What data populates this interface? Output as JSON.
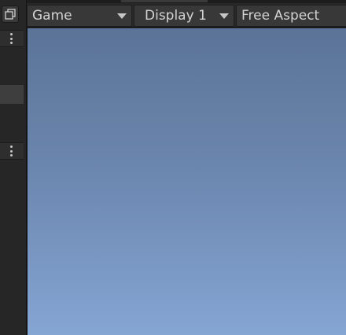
{
  "gameview": {
    "view_dropdown": "Game",
    "display_dropdown": "Display 1",
    "aspect_dropdown": "Free Aspect"
  },
  "colors": {
    "sky_top": "#5b7397",
    "sky_bottom": "#85a5d3",
    "panel_bg": "#262626",
    "dropdown_bg": "#383838"
  },
  "icons": {
    "maximize": "maximize-icon",
    "menu": "kebab-menu-icon",
    "dropdown": "triangle-down-icon"
  }
}
